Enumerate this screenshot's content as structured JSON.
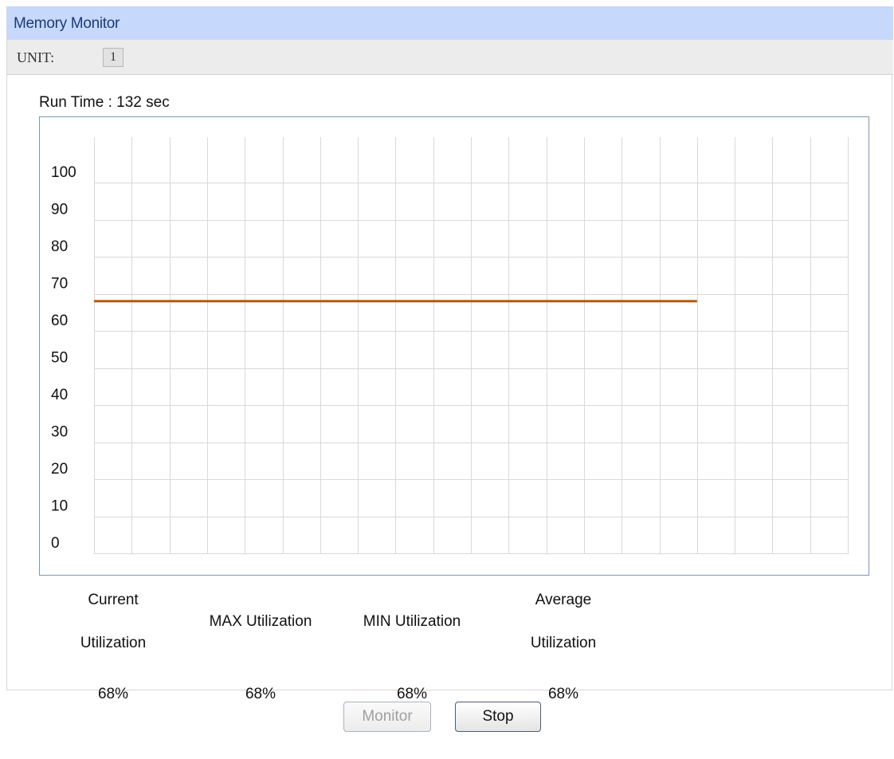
{
  "panel": {
    "title": "Memory Monitor",
    "unit_label": "UNIT:",
    "unit_value": "1"
  },
  "run_time": "Run Time : 132 sec",
  "stats": {
    "current_label": "Current Utilization",
    "current_label_line1": "Current",
    "current_label_line2": "Utilization",
    "max_label": "MAX Utilization",
    "min_label": "MIN Utilization",
    "average_label_line1": "Average",
    "average_label_line2": "Utilization",
    "current_value": "68%",
    "max_value": "68%",
    "min_value": "68%",
    "average_value": "68%"
  },
  "buttons": {
    "monitor_label": "Monitor",
    "monitor_enabled": false,
    "stop_label": "Stop"
  },
  "colors": {
    "header_bg": "#c6d8fb",
    "line_color": "#b45a12",
    "grid_color": "#d9d9d9",
    "chart_border": "#7c97b6"
  },
  "chart_data": {
    "type": "line",
    "title": "",
    "xlabel": "",
    "ylabel": "",
    "ylim": [
      0,
      100
    ],
    "y_ticks": [
      "100",
      "90",
      "80",
      "70",
      "60",
      "50",
      "40",
      "30",
      "20",
      "10",
      "0"
    ],
    "grid": true,
    "x_slots": 20,
    "series": [
      {
        "values": [
          68,
          68,
          68,
          68,
          68,
          68,
          68,
          68,
          68,
          68,
          68,
          68,
          68,
          68,
          68,
          68,
          68
        ]
      }
    ]
  }
}
